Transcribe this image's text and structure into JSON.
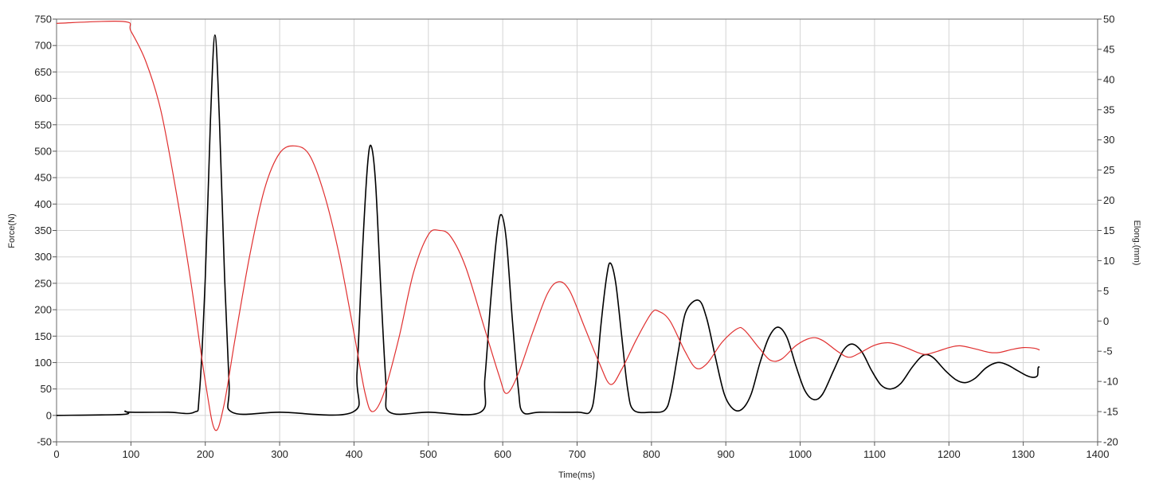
{
  "chart_data": {
    "type": "line",
    "xlabel": "Time(ms)",
    "ylabel_left": "Force(N)",
    "ylabel_right": "Elong.(mm)",
    "xlim": [
      0,
      1400
    ],
    "ylim_left": [
      -50,
      750
    ],
    "ylim_right": [
      -20,
      50
    ],
    "x_ticks": [
      0,
      100,
      200,
      300,
      400,
      500,
      600,
      700,
      800,
      900,
      1000,
      1100,
      1200,
      1300,
      1400
    ],
    "y_left_ticks": [
      -50,
      0,
      50,
      100,
      150,
      200,
      250,
      300,
      350,
      400,
      450,
      500,
      550,
      600,
      650,
      700,
      750
    ],
    "y_right_ticks": [
      -20,
      -15,
      -10,
      -5,
      0,
      5,
      10,
      15,
      20,
      25,
      30,
      35,
      40,
      45,
      50
    ],
    "grid": true,
    "legend": "none",
    "series": [
      {
        "axis": "left",
        "color": "#000000",
        "points": [
          [
            0,
            0
          ],
          [
            90,
            2
          ],
          [
            92,
            8
          ],
          [
            100,
            6
          ],
          [
            150,
            6
          ],
          [
            185,
            6
          ],
          [
            192,
            40
          ],
          [
            200,
            260
          ],
          [
            207,
            560
          ],
          [
            213,
            720
          ],
          [
            219,
            560
          ],
          [
            226,
            260
          ],
          [
            232,
            60
          ],
          [
            236,
            6
          ],
          [
            300,
            6
          ],
          [
            398,
            6
          ],
          [
            404,
            80
          ],
          [
            411,
            300
          ],
          [
            418,
            470
          ],
          [
            423,
            510
          ],
          [
            429,
            440
          ],
          [
            436,
            240
          ],
          [
            443,
            60
          ],
          [
            448,
            6
          ],
          [
            500,
            6
          ],
          [
            570,
            6
          ],
          [
            576,
            70
          ],
          [
            584,
            220
          ],
          [
            592,
            340
          ],
          [
            598,
            380
          ],
          [
            605,
            330
          ],
          [
            613,
            180
          ],
          [
            621,
            50
          ],
          [
            627,
            6
          ],
          [
            650,
            6
          ],
          [
            700,
            6
          ],
          [
            718,
            8
          ],
          [
            725,
            60
          ],
          [
            732,
            170
          ],
          [
            740,
            265
          ],
          [
            745,
            288
          ],
          [
            752,
            250
          ],
          [
            760,
            150
          ],
          [
            768,
            50
          ],
          [
            776,
            10
          ],
          [
            800,
            6
          ],
          [
            818,
            10
          ],
          [
            826,
            40
          ],
          [
            836,
            120
          ],
          [
            846,
            195
          ],
          [
            863,
            218
          ],
          [
            874,
            185
          ],
          [
            886,
            110
          ],
          [
            898,
            40
          ],
          [
            910,
            12
          ],
          [
            922,
            12
          ],
          [
            934,
            40
          ],
          [
            946,
            100
          ],
          [
            958,
            148
          ],
          [
            970,
            167
          ],
          [
            982,
            148
          ],
          [
            994,
            95
          ],
          [
            1006,
            48
          ],
          [
            1018,
            30
          ],
          [
            1030,
            40
          ],
          [
            1045,
            85
          ],
          [
            1058,
            123
          ],
          [
            1070,
            135
          ],
          [
            1083,
            120
          ],
          [
            1096,
            85
          ],
          [
            1109,
            57
          ],
          [
            1122,
            50
          ],
          [
            1135,
            60
          ],
          [
            1150,
            90
          ],
          [
            1162,
            110
          ],
          [
            1170,
            115
          ],
          [
            1180,
            108
          ],
          [
            1195,
            85
          ],
          [
            1210,
            67
          ],
          [
            1222,
            62
          ],
          [
            1235,
            70
          ],
          [
            1250,
            90
          ],
          [
            1265,
            100
          ],
          [
            1278,
            96
          ],
          [
            1292,
            85
          ],
          [
            1305,
            75
          ],
          [
            1313,
            72
          ],
          [
            1319,
            75
          ],
          [
            1320,
            90
          ],
          [
            1322,
            92
          ]
        ]
      },
      {
        "axis": "right",
        "color": "#e03030",
        "points": [
          [
            0,
            49.3
          ],
          [
            90,
            49.6
          ],
          [
            100,
            48
          ],
          [
            120,
            43
          ],
          [
            140,
            35
          ],
          [
            160,
            22
          ],
          [
            180,
            7
          ],
          [
            200,
            -10
          ],
          [
            213,
            -18
          ],
          [
            225,
            -14
          ],
          [
            240,
            -3
          ],
          [
            260,
            11
          ],
          [
            280,
            22
          ],
          [
            300,
            27.8
          ],
          [
            320,
            29
          ],
          [
            340,
            27.5
          ],
          [
            360,
            21
          ],
          [
            380,
            11
          ],
          [
            400,
            -2
          ],
          [
            415,
            -12
          ],
          [
            425,
            -15
          ],
          [
            440,
            -12
          ],
          [
            460,
            -3
          ],
          [
            480,
            8
          ],
          [
            500,
            14.3
          ],
          [
            515,
            15
          ],
          [
            530,
            14
          ],
          [
            550,
            9
          ],
          [
            575,
            -1
          ],
          [
            595,
            -9
          ],
          [
            605,
            -12
          ],
          [
            620,
            -9
          ],
          [
            640,
            -2
          ],
          [
            660,
            4.5
          ],
          [
            675,
            6.5
          ],
          [
            690,
            5
          ],
          [
            710,
            -1
          ],
          [
            730,
            -7
          ],
          [
            745,
            -10.5
          ],
          [
            760,
            -8
          ],
          [
            780,
            -3
          ],
          [
            800,
            1.3
          ],
          [
            810,
            1.6
          ],
          [
            825,
            0
          ],
          [
            845,
            -5
          ],
          [
            860,
            -7.8
          ],
          [
            875,
            -7
          ],
          [
            895,
            -3.5
          ],
          [
            915,
            -1.3
          ],
          [
            925,
            -1.5
          ],
          [
            945,
            -4.5
          ],
          [
            960,
            -6.5
          ],
          [
            975,
            -6.3
          ],
          [
            995,
            -4
          ],
          [
            1015,
            -2.8
          ],
          [
            1030,
            -3.2
          ],
          [
            1050,
            -5
          ],
          [
            1065,
            -6
          ],
          [
            1080,
            -5.3
          ],
          [
            1100,
            -4
          ],
          [
            1120,
            -3.6
          ],
          [
            1140,
            -4.3
          ],
          [
            1160,
            -5.3
          ],
          [
            1170,
            -5.5
          ],
          [
            1185,
            -5
          ],
          [
            1200,
            -4.4
          ],
          [
            1215,
            -4.1
          ],
          [
            1235,
            -4.6
          ],
          [
            1255,
            -5.2
          ],
          [
            1268,
            -5.2
          ],
          [
            1285,
            -4.7
          ],
          [
            1300,
            -4.4
          ],
          [
            1315,
            -4.5
          ],
          [
            1322,
            -4.8
          ]
        ]
      }
    ]
  }
}
